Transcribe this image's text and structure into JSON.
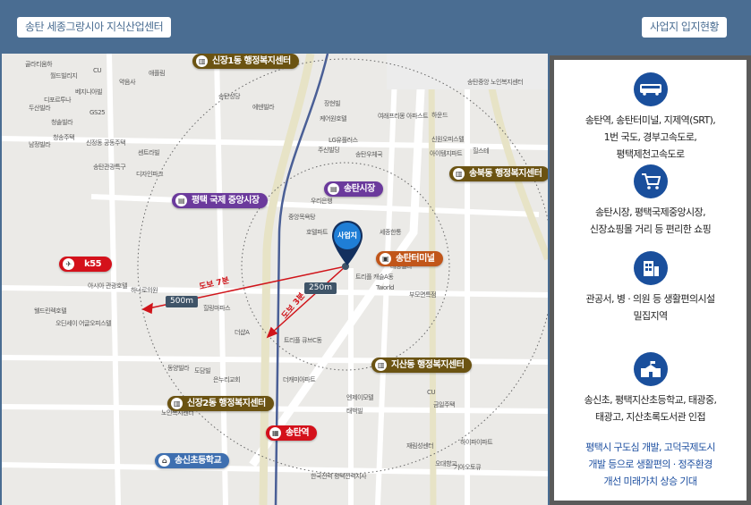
{
  "header": {
    "title": "송탄 세종그랑시아  지식산업센터",
    "section": "사업지 입지현황",
    "bg_color": "#4a6d92"
  },
  "map": {
    "site_label": "사업지",
    "pois": [
      {
        "label": "신장1동 행정복지센터",
        "icon": "government-icon",
        "color": "#6b5312"
      },
      {
        "label": "송북동 행정복지센터",
        "icon": "government-icon",
        "color": "#6b5312"
      },
      {
        "label": "평택 국제 중앙시장",
        "icon": "market-icon",
        "color": "#6b3a9c"
      },
      {
        "label": "송탄시장",
        "icon": "market-icon",
        "color": "#6b3a9c"
      },
      {
        "label": "송탄터미널",
        "icon": "bus-icon",
        "color": "#c1561a"
      },
      {
        "label": "k55",
        "icon": "airplane-icon",
        "color": "#d4111b"
      },
      {
        "label": "지산동 행정복지센터",
        "icon": "government-icon",
        "color": "#6b5312"
      },
      {
        "label": "신장2동 행정복지센터",
        "icon": "government-icon",
        "color": "#6b5312"
      },
      {
        "label": "송탄역",
        "icon": "train-icon",
        "color": "#d4111b"
      },
      {
        "label": "송신초등학교",
        "icon": "school-icon",
        "color": "#3e6fb0"
      }
    ],
    "distances": {
      "near": "250m",
      "far": "500m"
    },
    "walk": {
      "near": "도보 3분",
      "far": "도보 7분"
    },
    "places": [
      "골라티움하",
      "월드빌리지",
      "CU",
      "약음사",
      "애플림",
      "베지니아빌",
      "디포르투나",
      "두산빌라",
      "GS25",
      "청솔빌라",
      "청송주택",
      "신정동 공동주택",
      "남정빌라",
      "센트라빌",
      "송탄관광특구",
      "디자인파크",
      "송탄성당",
      "에덴빌라",
      "장현빌",
      "케어원호텔",
      "LG유플러스",
      "주신빌딩",
      "송탄우체국",
      "여래프리몽 아파스트",
      "하운드",
      "신원오피스텔",
      "아이템지파트",
      "힐스테",
      "송탄중앙 노인복지센터",
      "중앙목욕탕",
      "우리은행",
      "호텔파트",
      "트리플 캐슬A동",
      "세종한통",
      "대성빌라",
      "Tworld",
      "부모면특점",
      "아시아 관광호텔",
      "하나로의원",
      "힐링마파스",
      "웰드린렉호텔",
      "오딘세이 어글오피스텔",
      "더샵A",
      "트리플 큐브C동",
      "동양빌라",
      "도담빌",
      "은누리교회",
      "노인복지센터",
      "한국전력 평택전력지사",
      "더캐미아파트",
      "엔제이모텔",
      "태백빌",
      "금일주택",
      "CU",
      "하이파이파트",
      "오대향교",
      "재림성센터",
      "기아오토큐"
    ]
  },
  "panel": {
    "features": [
      {
        "icon": "bus-icon",
        "lines": [
          "송탄역, 송탄터미널, 지제역(SRT),",
          "1번 국도, 경부고속도로,",
          "평택제천고속도로"
        ]
      },
      {
        "icon": "shopping-cart-icon",
        "lines": [
          "송탄시장, 평택국제중앙시장,",
          "신장쇼핑몰 거리 등 편리한 쇼핑"
        ]
      },
      {
        "icon": "building-icon",
        "lines": [
          "관공서, 병 · 의원 등 생활편의시설",
          "밀집지역"
        ]
      },
      {
        "icon": "school-icon",
        "lines": [
          "송신초, 평택지산초등학교, 태광중,",
          "태광고, 지산초록도서관 인접"
        ]
      }
    ],
    "summary": [
      "평택시 구도심 개발, 고덕국제도시",
      "개발 등으로 생활편의 · 정주환경",
      "개선 미래가치 상승 기대"
    ],
    "accent_color": "#1a4f9c"
  }
}
